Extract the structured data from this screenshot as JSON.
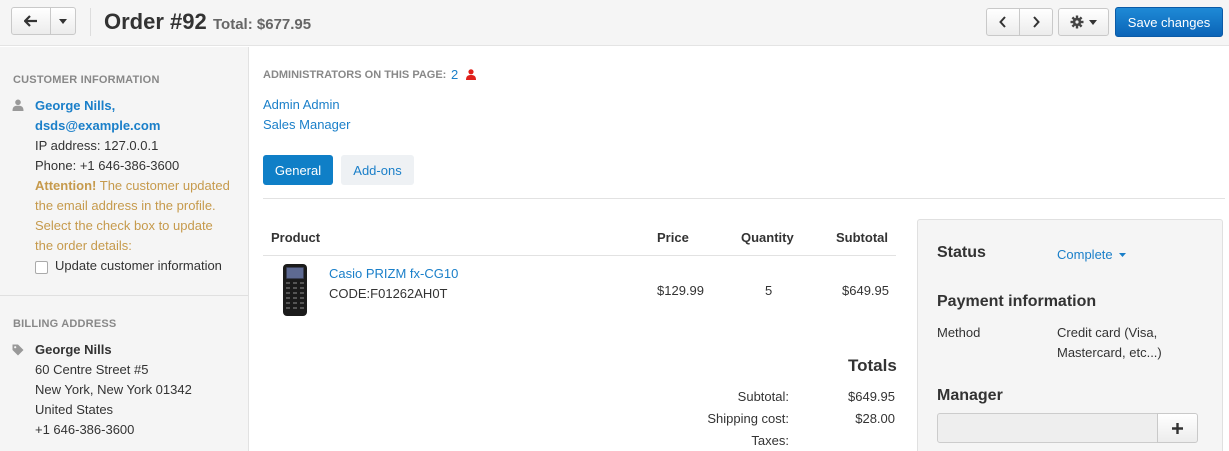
{
  "header": {
    "title": "Order #92",
    "total": "Total: $677.95",
    "save_label": "Save changes"
  },
  "customer": {
    "heading": "CUSTOMER INFORMATION",
    "name": "George Nills,",
    "email": "dsds@example.com",
    "ip": "IP address: 127.0.0.1",
    "phone": "Phone: +1 646-386-3600",
    "attention_label": "Attention!",
    "attention_line1": " The customer updated",
    "attention_line2": "the email address in the profile.",
    "attention_line3": "Select the check box to update",
    "attention_line4": "the order details:",
    "update_checkbox_label": "Update customer information"
  },
  "billing": {
    "heading": "BILLING ADDRESS",
    "name": "George Nills",
    "street": "60 Centre Street #5",
    "city": "New York, New York 01342",
    "country": "United States",
    "phone": "+1 646-386-3600"
  },
  "admins": {
    "label": "ADMINISTRATORS ON THIS PAGE:",
    "count": "2",
    "list": [
      "Admin Admin",
      "Sales Manager"
    ]
  },
  "tabs": [
    {
      "label": "General"
    },
    {
      "label": "Add-ons"
    }
  ],
  "table": {
    "headers": [
      "Product",
      "Price",
      "Quantity",
      "Subtotal"
    ],
    "rows": [
      {
        "name": "Casio PRIZM fx-CG10",
        "code": "CODE:F01262AH0T",
        "price": "$129.99",
        "quantity": "5",
        "subtotal": "$649.95"
      }
    ]
  },
  "totals": {
    "title": "Totals",
    "subtotal_label": "Subtotal:",
    "subtotal_value": "$649.95",
    "shipping_label": "Shipping cost:",
    "shipping_value": "$28.00",
    "taxes_label": "Taxes:"
  },
  "panel": {
    "status_heading": "Status",
    "status_value": "Complete",
    "payment_heading": "Payment information",
    "method_label": "Method",
    "method_value_line1": "Credit card (Visa,",
    "method_value_line2": "Mastercard, etc...)",
    "manager_heading": "Manager"
  },
  "colors": {
    "accent": "#1a7fc9",
    "primary_button": "#0b64b7",
    "warning": "#c69a4c",
    "admin_icon": "#e0201b"
  }
}
